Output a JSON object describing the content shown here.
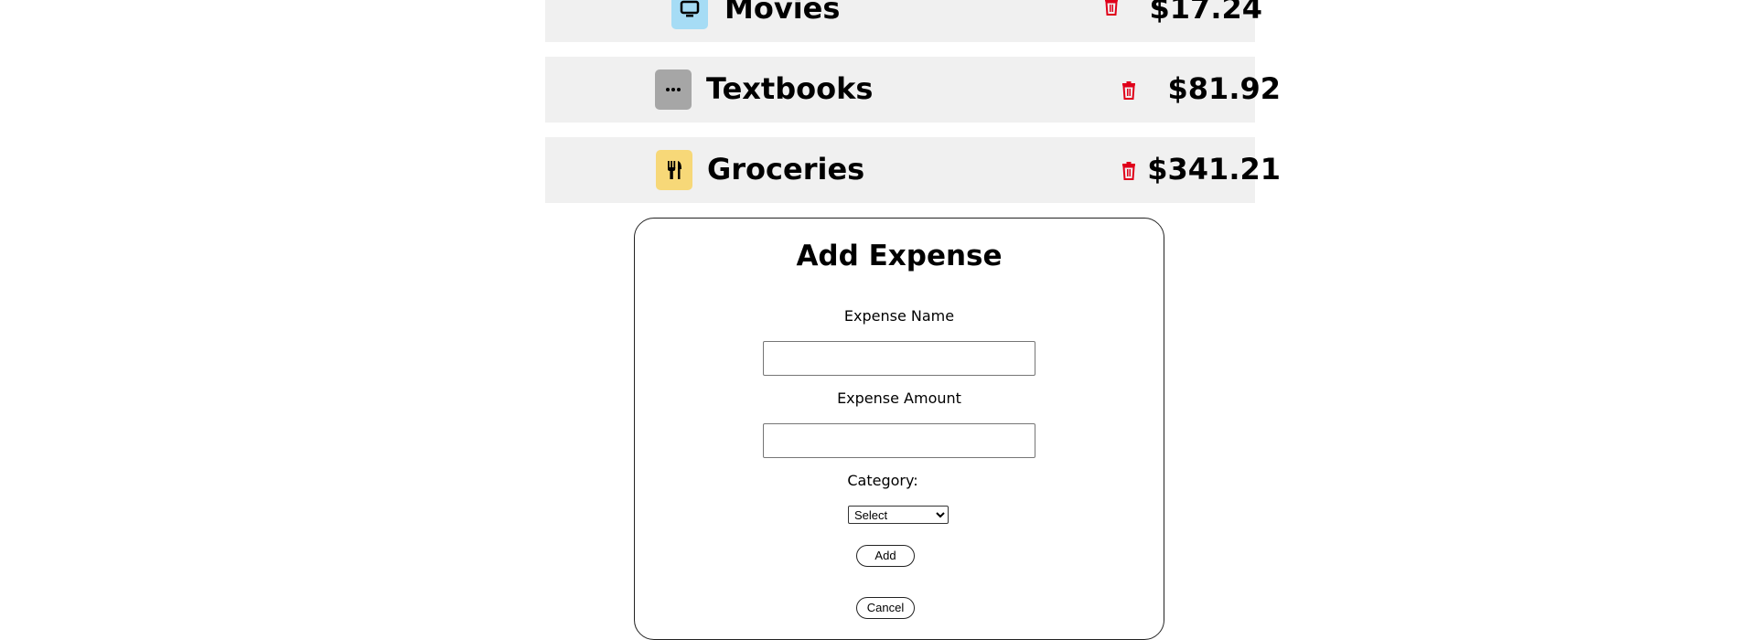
{
  "expenses": [
    {
      "name": "Movies",
      "amount": "$17.24",
      "icon": "tv-icon",
      "icon_color": "#a6dcf5"
    },
    {
      "name": "Textbooks",
      "amount": "$81.92",
      "icon": "more-icon",
      "icon_color": "#a6a6a6"
    },
    {
      "name": "Groceries",
      "amount": "$341.21",
      "icon": "utensils-icon",
      "icon_color": "#f7d878"
    }
  ],
  "delete_color": "#e0001a",
  "add_form": {
    "title": "Add Expense",
    "name_label": "Expense Name",
    "name_value": "",
    "amount_label": "Expense Amount",
    "amount_value": "",
    "category_label": "Category:",
    "category_selected": "Select",
    "add_label": "Add",
    "cancel_label": "Cancel"
  }
}
